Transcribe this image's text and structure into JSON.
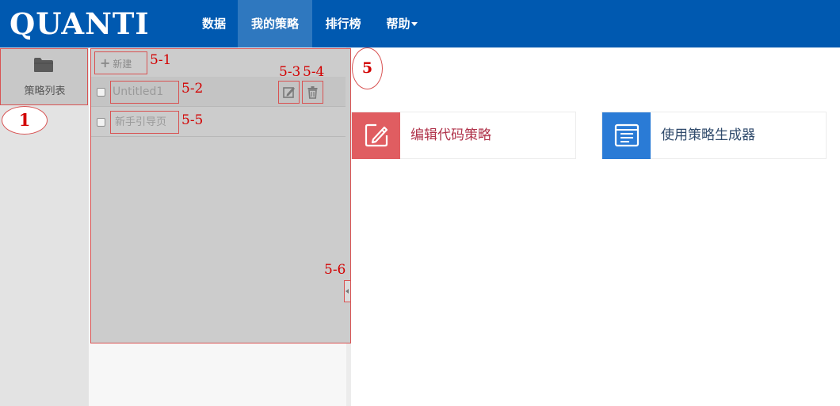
{
  "header": {
    "logo_text": "QUANTI",
    "nav": [
      {
        "label": "数据"
      },
      {
        "label": "我的策略",
        "active": true
      },
      {
        "label": "排行榜"
      },
      {
        "label": "帮助"
      }
    ]
  },
  "sidebar": {
    "strategy_list_label": "策略列表",
    "icon": "folder-icon"
  },
  "strategy_panel": {
    "new_button_label": "新建",
    "strategies": [
      {
        "name": "Untitled1",
        "checked": false
      },
      {
        "name": "新手引导页",
        "checked": false
      }
    ],
    "row_actions": [
      {
        "icon": "edit-icon"
      },
      {
        "icon": "trash-icon"
      }
    ]
  },
  "annotations": {
    "a1": "1",
    "a5": "5",
    "a5_1": "5-1",
    "a5_2": "5-2",
    "a5_3": "5-3",
    "a5_4": "5-4",
    "a5_5": "5-5",
    "a5_6": "5-6"
  },
  "main": {
    "cards": [
      {
        "label": "编辑代码策略",
        "icon": "pencil-edit-icon",
        "color": "#e05d61"
      },
      {
        "label": "使用策略生成器",
        "icon": "browser-window-icon",
        "color": "#2a7bd6"
      }
    ]
  },
  "colors": {
    "header_bg": "#0059b0",
    "nav_active_bg": "#2f78bf",
    "annotation": "#d20000"
  }
}
